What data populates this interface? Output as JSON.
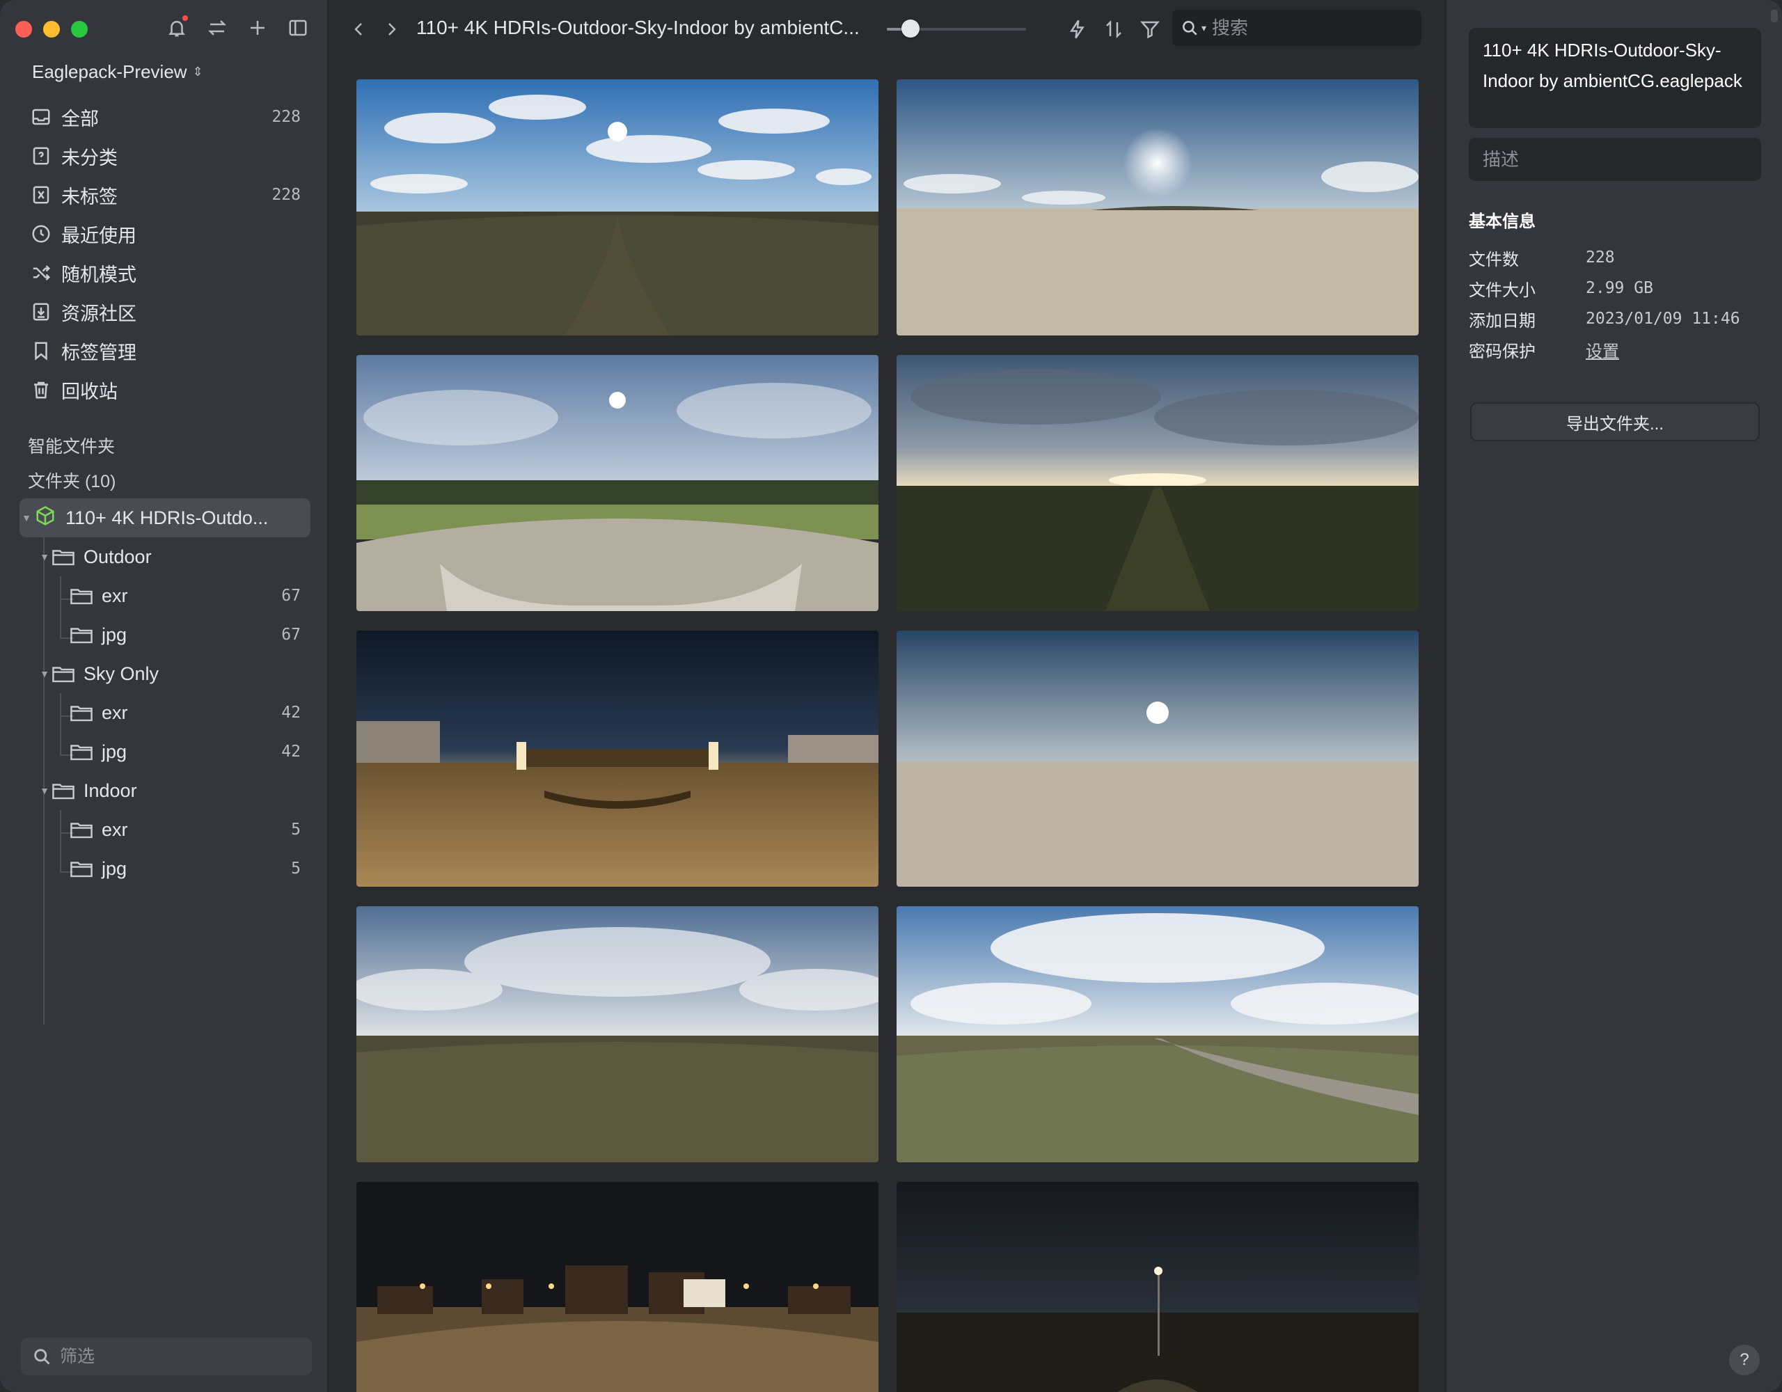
{
  "window": {
    "traffic_lights": [
      "close",
      "minimize",
      "zoom"
    ],
    "colors": {
      "close": "#ff5f57",
      "minimize": "#febc2e",
      "zoom": "#28c840",
      "accent_pack": "#7ed957"
    }
  },
  "sidebar": {
    "tools": [
      "bell-icon",
      "swap-icon",
      "plus-icon",
      "panel-icon"
    ],
    "library_name": "Eaglepack-Preview",
    "library_chevron": "⌃⌄",
    "items": [
      {
        "label": "全部",
        "count": "228",
        "icon": "all-icon"
      },
      {
        "label": "未分类",
        "count": "",
        "icon": "uncategorized-icon"
      },
      {
        "label": "未标签",
        "count": "228",
        "icon": "untagged-icon"
      },
      {
        "label": "最近使用",
        "count": "",
        "icon": "clock-icon"
      },
      {
        "label": "随机模式",
        "count": "",
        "icon": "shuffle-icon"
      },
      {
        "label": "资源社区",
        "count": "",
        "icon": "download-icon"
      },
      {
        "label": "标签管理",
        "count": "",
        "icon": "bookmark-icon"
      },
      {
        "label": "回收站",
        "count": "",
        "icon": "trash-icon"
      }
    ],
    "smart_folders_label": "智能文件夹",
    "folders_label": "文件夹 (10)",
    "tree": {
      "root": {
        "label": "110+ 4K HDRIs-Outdo...",
        "icon": "package-icon"
      },
      "groups": [
        {
          "label": "Outdoor",
          "children": [
            {
              "label": "exr",
              "count": "67"
            },
            {
              "label": "jpg",
              "count": "67"
            }
          ]
        },
        {
          "label": "Sky Only",
          "children": [
            {
              "label": "exr",
              "count": "42"
            },
            {
              "label": "jpg",
              "count": "42"
            }
          ]
        },
        {
          "label": "Indoor",
          "children": [
            {
              "label": "exr",
              "count": "5"
            },
            {
              "label": "jpg",
              "count": "5"
            }
          ]
        }
      ]
    },
    "filter_placeholder": "筛选"
  },
  "toolbar": {
    "title": "110+ 4K HDRIs-Outdoor-Sky-Indoor by ambientC...",
    "zoom_level": 0.17,
    "search_placeholder": "搜索"
  },
  "gallery": {
    "thumbnails": [
      "cloudy-field",
      "sandy-beach-sun",
      "plaza-overcast",
      "field-sunset",
      "night-promenade",
      "beach-haze",
      "field-cloudy",
      "field-path-clouds",
      "night-street",
      "night-lamp"
    ]
  },
  "inspector": {
    "file_name": "110+ 4K HDRIs-Outdoor-Sky-Indoor by ambientCG.eaglepack",
    "description_placeholder": "描述",
    "basic_info_title": "基本信息",
    "rows": [
      {
        "key": "文件数",
        "value": "228"
      },
      {
        "key": "文件大小",
        "value": "2.99 GB"
      },
      {
        "key": "添加日期",
        "value": "2023/01/09 11:46"
      },
      {
        "key": "密码保护",
        "value": "设置"
      }
    ],
    "export_label": "导出文件夹...",
    "help_label": "?"
  }
}
